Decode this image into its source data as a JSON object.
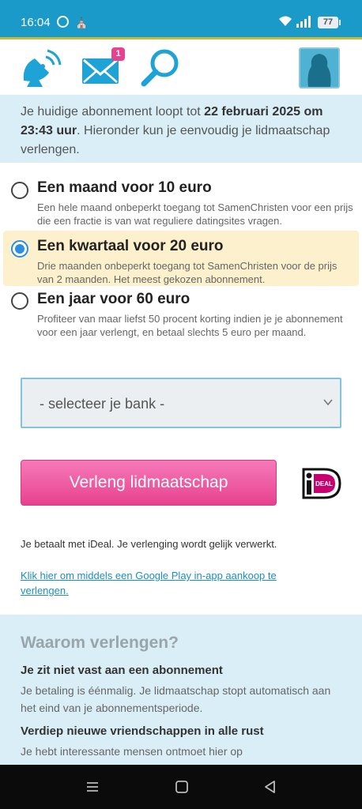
{
  "status_bar": {
    "time": "16:04",
    "battery": "77"
  },
  "nav": {
    "messages_badge": "1"
  },
  "subscription": {
    "prefix": "Je huidige abonnement loopt tot ",
    "end_date": "22 februari 2025 om 23:43 uur",
    "suffix": ". Hieronder kun je eenvoudig je lidmaatschap verlengen."
  },
  "options": [
    {
      "title": "Een maand voor 10 euro",
      "description": "Een hele maand onbeperkt toegang tot SamenChristen voor een prijs die een fractie is van wat reguliere datingsites vragen.",
      "selected": false
    },
    {
      "title": "Een kwartaal voor 20 euro",
      "description": "Drie maanden onbeperkt toegang tot SamenChristen voor de prijs van 2 maanden. Het meest gekozen abonnement.",
      "selected": true
    },
    {
      "title": "Een jaar voor 60 euro",
      "description": "Profiteer van maar liefst 50 procent korting indien je je abonnement voor een jaar verlengt, en betaal slechts 5 euro per maand.",
      "selected": false
    }
  ],
  "bank_select": {
    "placeholder": "- selecteer je bank -"
  },
  "renew_button": "Verleng lidmaatschap",
  "ideal_logo_text": "iDEAL",
  "payment_note": "Je betaalt met iDeal. Je verlenging wordt gelijk verwerkt.",
  "google_play_link": "Klik hier om middels een Google Play in-app aankoop te verlengen.",
  "why_section": {
    "title": "Waarom verlengen?",
    "points": [
      {
        "heading": "Je zit niet vast aan een abonnement",
        "text": "Je betaling is éénmalig. Je lidmaatschap stopt automatisch aan het eind van je abonnementsperiode."
      },
      {
        "heading": "Verdiep nieuwe vriendschappen in alle rust",
        "text": "Je hebt interessante mensen ontmoet hier op"
      }
    ]
  },
  "colors": {
    "brand_blue": "#1a9ac8",
    "accent_pink": "#e8418e",
    "selected_bg": "#fdf0cc",
    "info_bg": "#daeef7"
  }
}
